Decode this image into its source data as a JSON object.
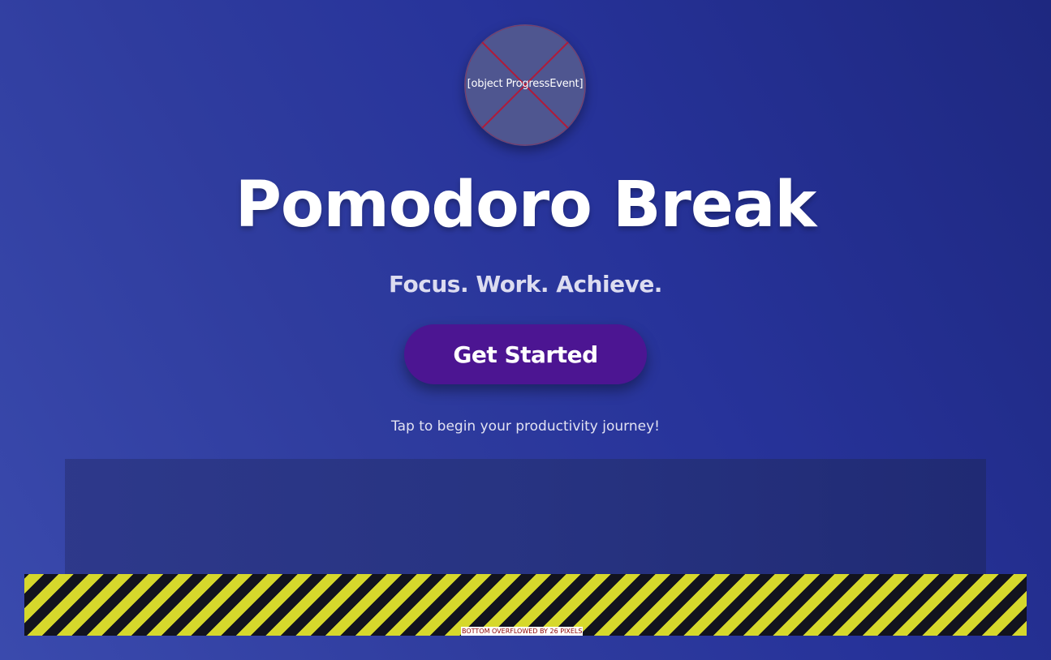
{
  "logo": {
    "alt_text": "[object ProgressEvent]",
    "icon": "broken-image-icon"
  },
  "title": "Pomodoro Break",
  "subtitle": "Focus. Work. Achieve.",
  "cta": {
    "label": "Get Started"
  },
  "hint": "Tap to begin your productivity journey!",
  "debug": {
    "overflow_message": "BOTTOM OVERFLOWED BY 26 PIXELS"
  },
  "colors": {
    "background_start": "#3a4aad",
    "background_end": "#1e2880",
    "button": "#4c1592",
    "broken_image_cross": "#b01b3a",
    "overflow_stripe_yellow": "#d6d82c",
    "overflow_stripe_dark": "#12131e",
    "overflow_text": "#8b0000"
  }
}
